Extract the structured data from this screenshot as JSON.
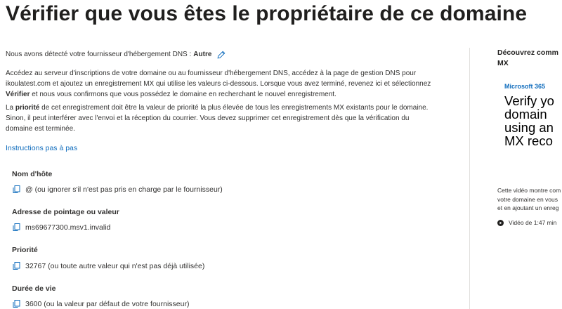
{
  "page": {
    "title": "Vérifier que vous êtes le propriétaire de ce domaine"
  },
  "provider": {
    "text": "Nous avons détecté votre fournisseur d'hébergement DNS :",
    "name": "Autre"
  },
  "paragraph1": {
    "line1": "Accédez au serveur d'inscriptions de votre domaine ou au fournisseur d'hébergement DNS, accédez à la page de gestion DNS pour",
    "line2": "ikoulatest.com et ajoutez un enregistrement MX qui utilise les valeurs ci-dessous. Lorsque vous avez terminé, revenez ici et sélectionnez",
    "bold": "Vérifier",
    "line3_rest": "et nous vous confirmons que vous possédez le domaine en recherchant le nouvel enregistrement."
  },
  "paragraph2": {
    "prefix": "La",
    "bold": "priorité",
    "line1_rest": "de cet enregistrement doit être la valeur de priorité la plus élevée de tous les enregistrements MX existants pour le domaine.",
    "line2": "Sinon, il peut interférer avec l'envoi et la réception du courrier. Vous devez supprimer cet enregistrement dès que la vérification du",
    "line3": "domaine est terminée."
  },
  "instructions_link": "Instructions pas à pas",
  "fields": [
    {
      "label": "Nom d'hôte",
      "value": "@ (ou ignorer s'il n'est pas pris en charge par le fournisseur)"
    },
    {
      "label": "Adresse de pointage ou valeur",
      "value": "ms69677300.msv1.invalid"
    },
    {
      "label": "Priorité",
      "value": "32767 (ou toute autre valeur qui n'est pas déjà utilisée)"
    },
    {
      "label": "Durée de vie",
      "value": "3600 (ou la valeur par défaut de votre fournisseur)"
    }
  ],
  "sidebar": {
    "title": "Découvrez comm\nMX",
    "brand": "Microsoft 365",
    "headline": "Verify yo\ndomain\nusing an\nMX reco",
    "description": "Cette vidéo montre com\nvotre domaine en vous\net en ajoutant un enreg",
    "duration": "Vidéo de 1:47 min"
  },
  "icons": {
    "edit": "pencil-icon",
    "copy": "copy-icon",
    "play": "play-icon"
  },
  "colors": {
    "accent": "#0f6cbd",
    "text": "#323130",
    "divider": "#e1dfdd"
  }
}
